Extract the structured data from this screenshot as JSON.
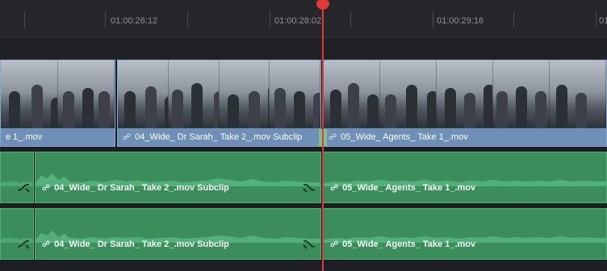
{
  "timeline": {
    "timecodes": [
      "01:00:26:12",
      "01:00:28:02",
      "01:00:29:16",
      "01"
    ],
    "video_track": {
      "clips": [
        {
          "label": "e 1_.mov",
          "show_link": false
        },
        {
          "label": "04_Wide_ Dr Sarah_ Take 2_.mov Subclip",
          "show_link": true
        },
        {
          "label": "05_Wide_ Agents_ Take 1_.mov",
          "show_link": true
        }
      ]
    },
    "audio_tracks": [
      {
        "clips": [
          {
            "label": "04_Wide_ Dr Sarah_ Take 2_.mov Subclip"
          },
          {
            "label": "05_Wide_ Agents_ Take 1_.mov"
          }
        ]
      },
      {
        "clips": [
          {
            "label": "04_Wide_ Dr Sarah_ Take 2_.mov Subclip"
          },
          {
            "label": "05_Wide_ Agents_ Take 1_.mov"
          }
        ]
      }
    ],
    "colors": {
      "video_clip": "#6e8fb8",
      "audio_clip": "#3b8e5b",
      "playhead": "#e1383a"
    },
    "icons": {
      "link": "link-icon",
      "fade": "fade-handle-icon",
      "playhead": "playhead-icon"
    }
  }
}
